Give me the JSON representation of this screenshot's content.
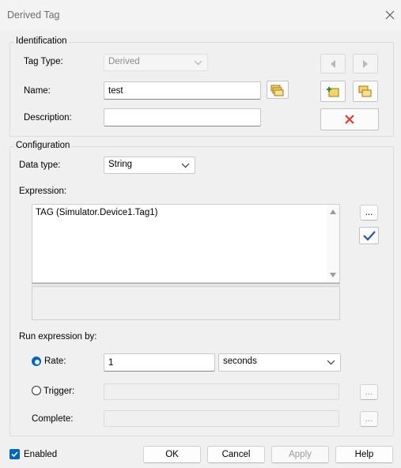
{
  "window": {
    "title": "Derived Tag"
  },
  "identification": {
    "legend": "Identification",
    "tag_type_label": "Tag Type:",
    "tag_type_value": "Derived",
    "name_label": "Name:",
    "name_value": "test",
    "description_label": "Description:",
    "description_value": ""
  },
  "configuration": {
    "legend": "Configuration",
    "data_type_label": "Data type:",
    "data_type_value": "String",
    "expression_label": "Expression:",
    "expression_value": "TAG (Simulator.Device1.Tag1)",
    "browse_label": "...",
    "run_label": "Run expression by:",
    "rate_label": "Rate:",
    "rate_value": "1",
    "rate_unit": "seconds",
    "trigger_label": "Trigger:",
    "trigger_value": "",
    "trigger_browse": "...",
    "complete_label": "Complete:",
    "complete_value": "",
    "complete_browse": "..."
  },
  "footer": {
    "enabled_label": "Enabled",
    "ok": "OK",
    "cancel": "Cancel",
    "apply": "Apply",
    "help": "Help"
  },
  "colors": {
    "accent": "#0067c0",
    "delete_red": "#e53935"
  }
}
